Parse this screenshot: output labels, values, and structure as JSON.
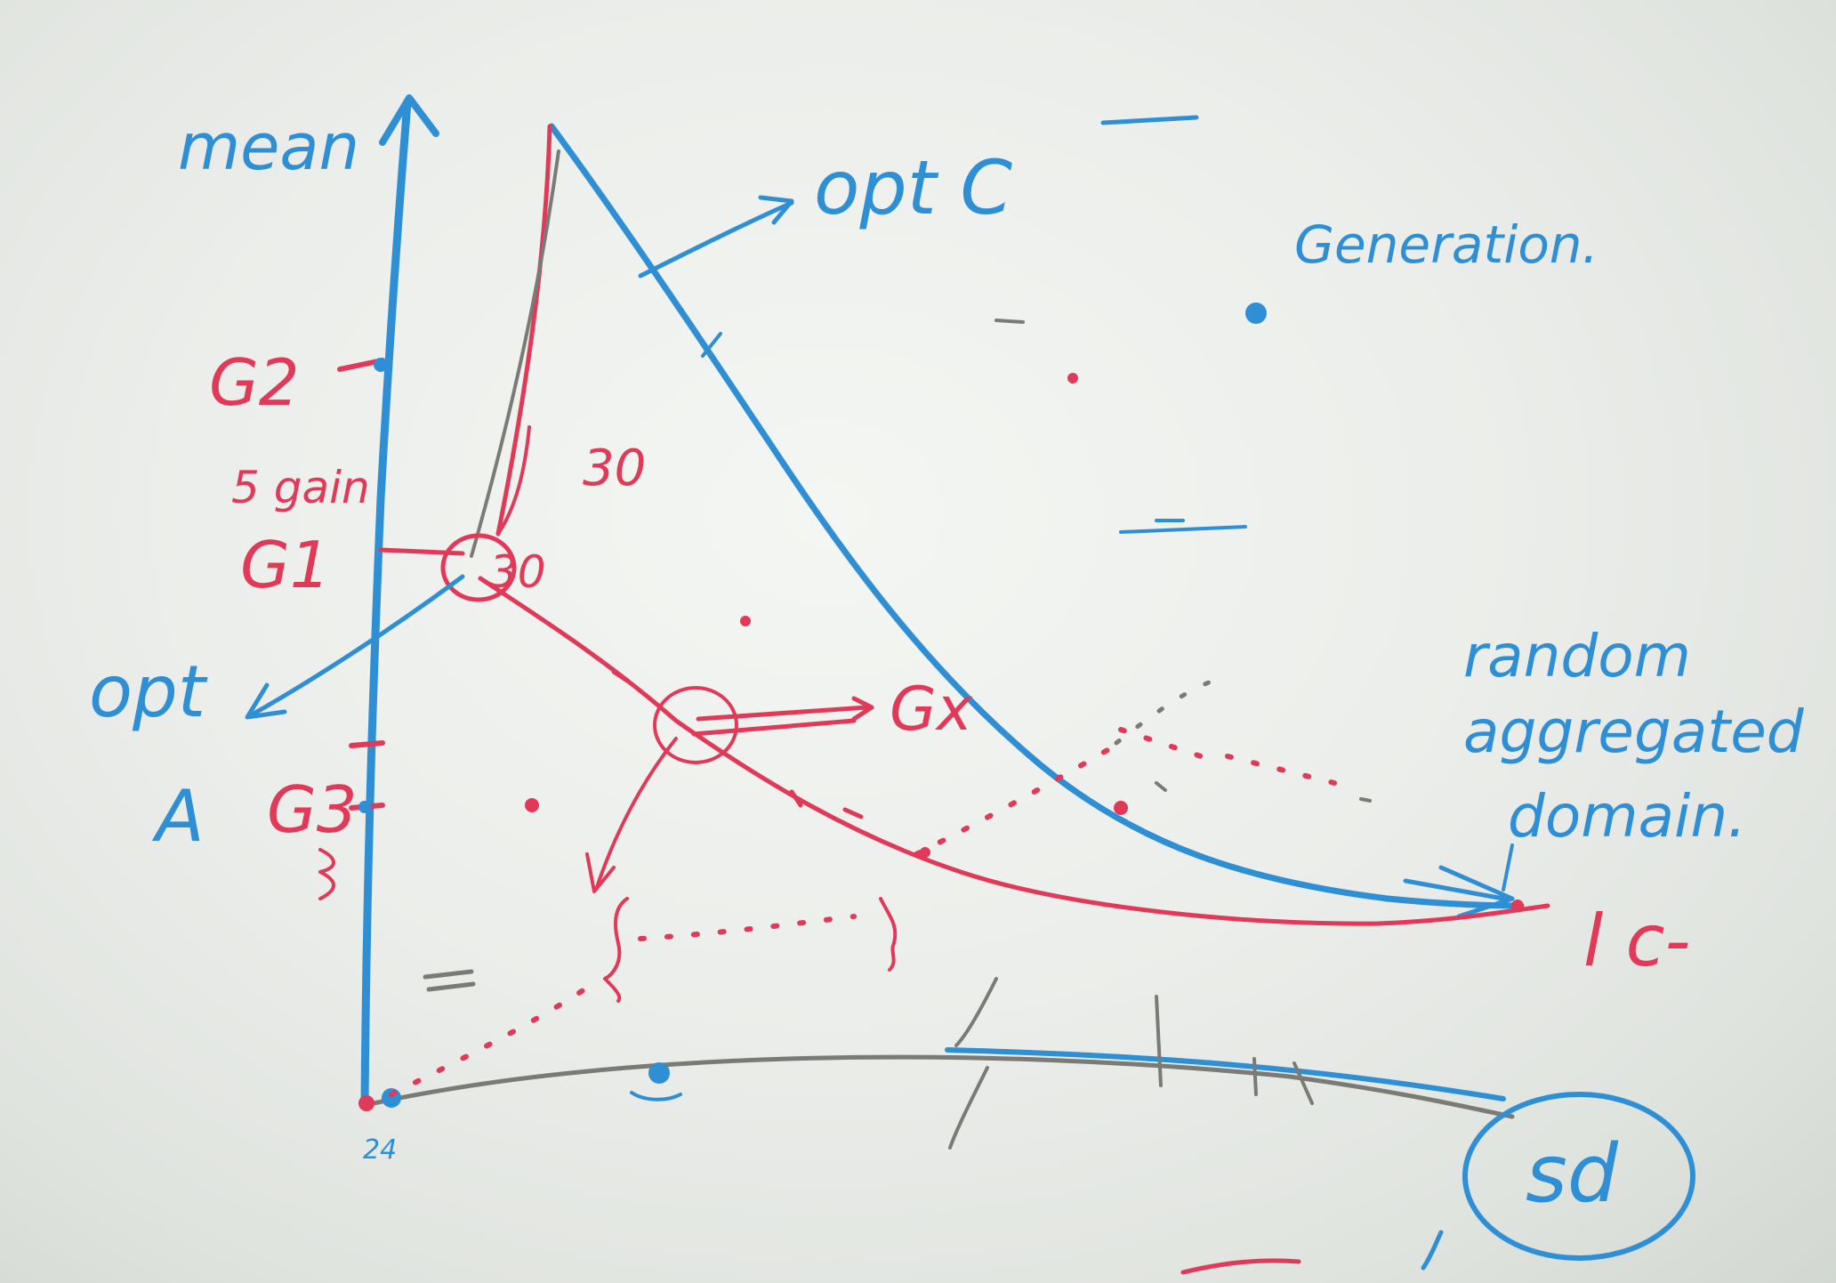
{
  "labels": {
    "y_axis": "mean",
    "x_axis": "sd",
    "opt_c": "opt C",
    "opt_a_1": "opt",
    "opt_a_2": "A",
    "generation": "Generation.",
    "random_1": "random",
    "random_2": "aggregated",
    "random_3": "domain.",
    "g2": "G2",
    "g1": "G1",
    "g3": "G3",
    "gx": "Gx",
    "gain": "5 gain",
    "thirty_a": "30",
    "thirty_b": "30",
    "lc": "l c-",
    "origin": "24"
  },
  "colors": {
    "marker_blue": "#2e8fd4",
    "marker_red": "#e03a58",
    "marker_gray": "#7a7a76",
    "board": "#eceeeb"
  }
}
